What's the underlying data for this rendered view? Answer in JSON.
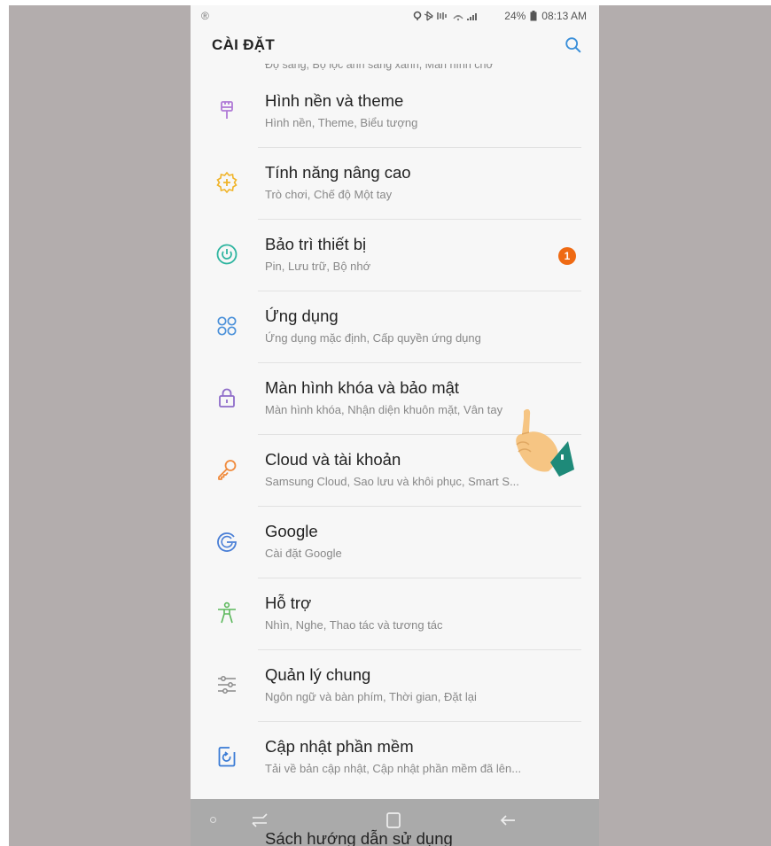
{
  "status_bar": {
    "left_icon": "registered-icon",
    "left_symbol": "®",
    "icons": "location bluetooth vibrate wifi signal",
    "battery": "24%",
    "time": "08:13 AM"
  },
  "header": {
    "title": "CÀI ĐẶT",
    "search_icon": "search-icon"
  },
  "cut_item": {
    "subtitle": "Độ sáng, Bộ lọc ánh sáng xanh, Màn hình chờ"
  },
  "items": [
    {
      "label": "Hình nền và theme",
      "subtitle": "Hình nền, Theme, Biểu tượng",
      "icon": "paintbrush-icon",
      "color": "#b07ad6"
    },
    {
      "label": "Tính năng nâng cao",
      "subtitle": "Trò chơi, Chế độ Một tay",
      "icon": "gear-plus-icon",
      "color": "#f0b429"
    },
    {
      "label": "Bảo trì thiết bị",
      "subtitle": "Pin, Lưu trữ, Bộ nhớ",
      "icon": "device-care-icon",
      "color": "#2fb5a0",
      "badge": "1"
    },
    {
      "label": "Ứng dụng",
      "subtitle": "Ứng dụng mặc định, Cấp quyền ứng dụng",
      "icon": "apps-icon",
      "color": "#4a90d9"
    },
    {
      "label": "Màn hình khóa và bảo mật",
      "subtitle": "Màn hình khóa, Nhận diện khuôn mặt, Vân tay",
      "icon": "lock-icon",
      "color": "#8e6cc9"
    },
    {
      "label": "Cloud và tài khoản",
      "subtitle": "Samsung Cloud, Sao lưu và khôi phục, Smart S...",
      "icon": "key-icon",
      "color": "#f08a3c"
    },
    {
      "label": "Google",
      "subtitle": "Cài đặt Google",
      "icon": "google-icon",
      "color": "#4a7fd6"
    },
    {
      "label": "Hỗ trợ",
      "subtitle": "Nhìn, Nghe, Thao tác và tương tác",
      "icon": "accessibility-icon",
      "color": "#5cb85c"
    },
    {
      "label": "Quản lý chung",
      "subtitle": "Ngôn ngữ và bàn phím, Thời gian, Đặt lại",
      "icon": "sliders-icon",
      "color": "#8a8a8a"
    },
    {
      "label": "Cập nhật phần mềm",
      "subtitle": "Tải về bản cập nhật, Cập nhật phần mềm đã lên...",
      "icon": "software-update-icon",
      "color": "#3a7bd5"
    }
  ],
  "under_nav_item": {
    "label": "Sách hướng dẫn sử dụng"
  },
  "nav_bar": {
    "buttons": [
      "recents-icon",
      "home-icon",
      "back-icon"
    ]
  },
  "overlay": {
    "icon": "pointing-hand-icon"
  }
}
